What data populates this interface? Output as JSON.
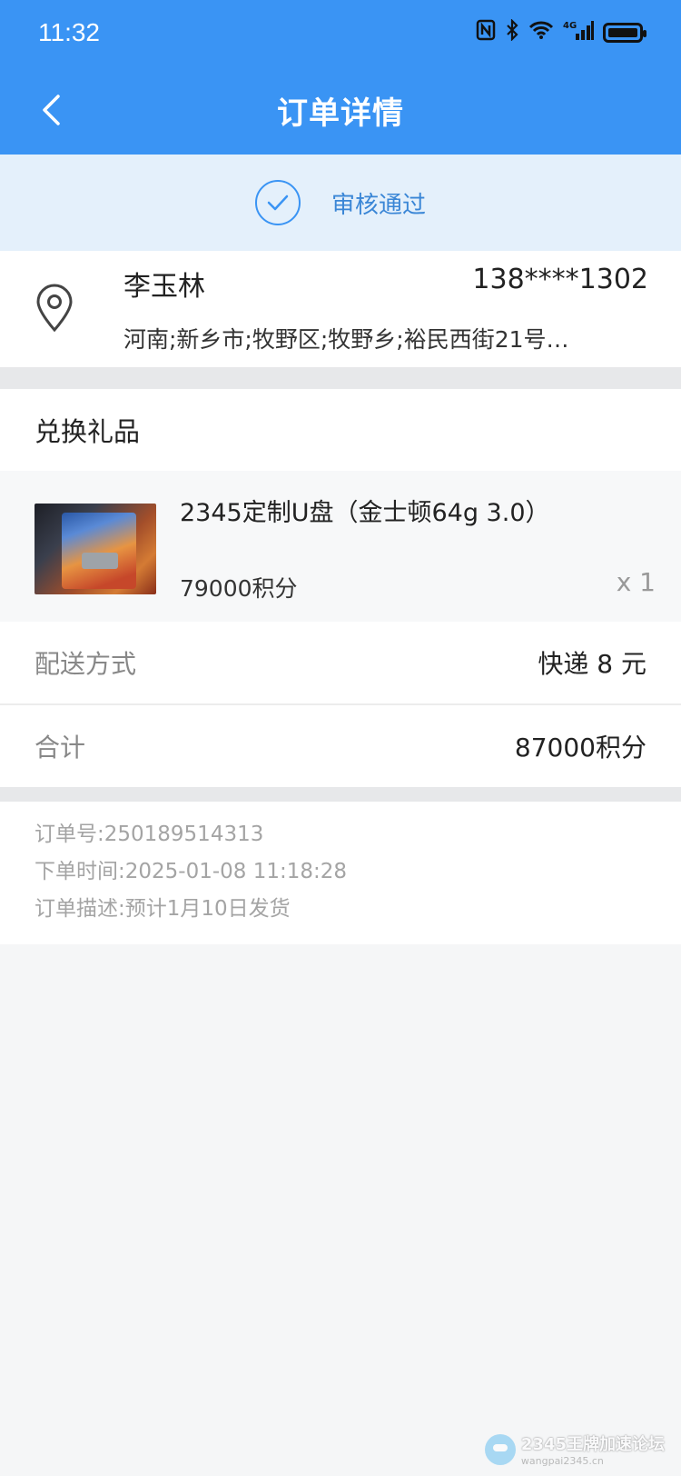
{
  "status_bar": {
    "time": "11:32",
    "icons": [
      "nfc-icon",
      "bluetooth-icon",
      "wifi-icon",
      "signal-icon",
      "battery-icon"
    ],
    "network_label": "4G"
  },
  "nav": {
    "title": "订单详情",
    "back_icon": "chevron-left-icon"
  },
  "status": {
    "text": "审核通过",
    "icon": "check-circle-icon"
  },
  "address": {
    "name": "李玉林",
    "phone": "138****1302",
    "detail": "河南;新乡市;牧野区;牧野乡;裕民西街21号…",
    "icon": "location-pin-icon"
  },
  "gift_section": {
    "title": "兑换礼品"
  },
  "product": {
    "name": "2345定制U盘（金士顿64g 3.0）",
    "points": "79000积分",
    "quantity": "x 1"
  },
  "delivery": {
    "label": "配送方式",
    "value": "快递 8 元"
  },
  "total": {
    "label": "合计",
    "value": "87000积分"
  },
  "order_info": {
    "order_no": "订单号:250189514313",
    "order_time": "下单时间:2025-01-08 11:18:28",
    "description": "订单描述:预计1月10日发货"
  },
  "watermark": {
    "title": "2345王牌加速论坛",
    "url": "wangpai2345.cn"
  },
  "colors": {
    "primary": "#3a94f4",
    "status_bg": "#e4f0fb",
    "status_text": "#3a86d6"
  }
}
